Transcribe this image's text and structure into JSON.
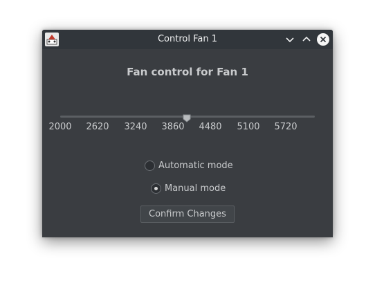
{
  "window": {
    "title": "Control Fan 1"
  },
  "heading": "Fan control for Fan 1",
  "slider": {
    "ticks": [
      "2000",
      "2620",
      "3240",
      "3860",
      "4480",
      "5100",
      "5720"
    ],
    "value_fraction": 0.5
  },
  "modes": {
    "automatic_label": "Automatic mode",
    "manual_label": "Manual mode",
    "selected": "manual"
  },
  "confirm_label": "Confirm Changes",
  "colors": {
    "window_bg": "#3a3d41",
    "titlebar_bg": "#31363b",
    "text": "#c9cbcd"
  },
  "icons": {
    "app": "fan-app-icon",
    "minimize": "chevron-down-icon",
    "maximize": "chevron-up-icon",
    "close": "close-icon"
  }
}
